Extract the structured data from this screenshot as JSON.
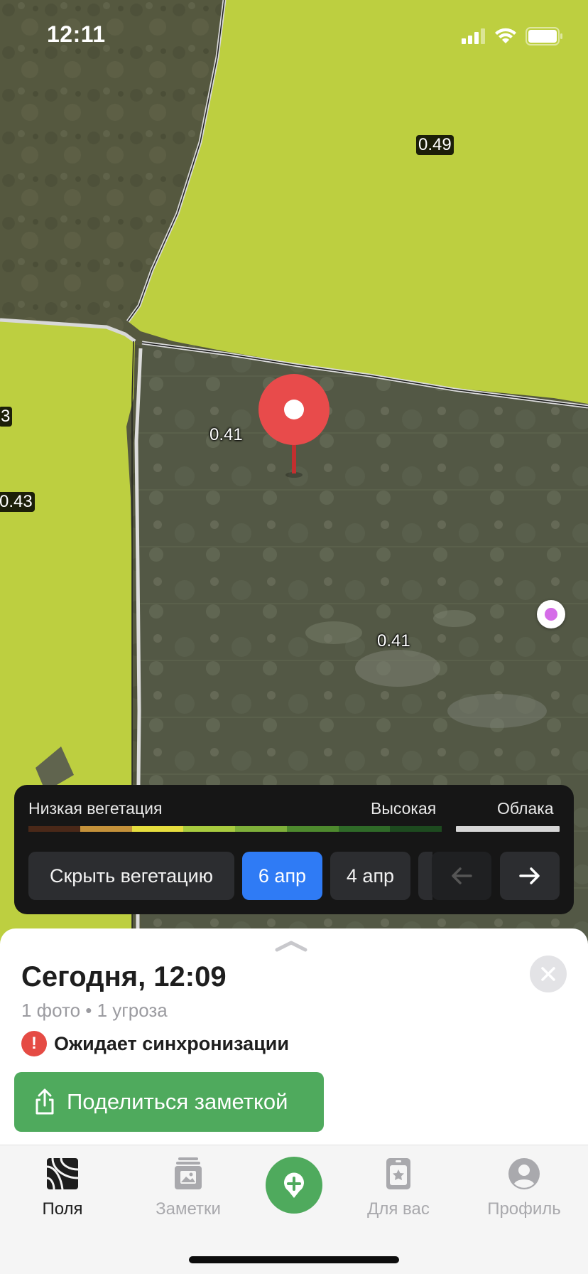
{
  "status_bar": {
    "time": "12:11",
    "battery_icon": "battery-icon",
    "wifi_icon": "wifi-icon",
    "signal_icon": "signal-icon"
  },
  "map": {
    "ndvi_labels": [
      "0.49",
      "3",
      "0.41",
      "0.43",
      "0.41"
    ],
    "field_color": "#bdcf40",
    "pin_color": "#e84b4b",
    "user_dot_color": "#d56ce8"
  },
  "vegetation_panel": {
    "low_label": "Низкая вегетация",
    "high_label": "Высокая",
    "cloud_label": "Облака",
    "scale_colors": [
      "#4a2818",
      "#c4913a",
      "#e6dd3e",
      "#a8cb3f",
      "#7fb03a",
      "#4e8a2e",
      "#2f6a28",
      "#1d4a1f"
    ],
    "hide_button": "Скрыть вегетацию",
    "dates": [
      "6 апр",
      "4 апр"
    ],
    "active_date_index": 0,
    "prev_icon": "arrow-left-icon",
    "next_icon": "arrow-right-icon"
  },
  "note": {
    "title": "Сегодня, 12:09",
    "subtitle": "1 фото • 1 угроза",
    "sync_status": "Ожидает синхронизации",
    "share_button": "Поделиться заметкой"
  },
  "tabbar": {
    "tabs": [
      {
        "label": "Поля",
        "icon": "fields-icon",
        "active": true
      },
      {
        "label": "Заметки",
        "icon": "notes-icon",
        "active": false
      },
      {
        "label": "Для вас",
        "icon": "for-you-icon",
        "active": false
      },
      {
        "label": "Профиль",
        "icon": "profile-icon",
        "active": false
      }
    ],
    "add_icon": "add-note-icon"
  }
}
